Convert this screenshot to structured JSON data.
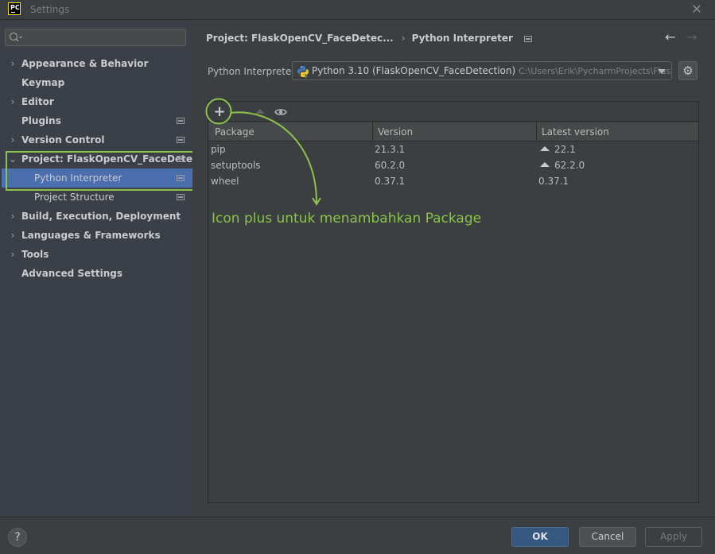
{
  "window": {
    "title": "Settings",
    "app_logo": "PC"
  },
  "sidebar": {
    "search": {
      "value": "",
      "placeholder": ""
    },
    "items": [
      {
        "label": "Appearance & Behavior",
        "expandable": true,
        "expanded": false
      },
      {
        "label": "Keymap",
        "expandable": false
      },
      {
        "label": "Editor",
        "expandable": true,
        "expanded": false
      },
      {
        "label": "Plugins",
        "expandable": false,
        "project_icon": true
      },
      {
        "label": "Version Control",
        "expandable": true,
        "expanded": false,
        "project_icon": true
      },
      {
        "label": "Project: FlaskOpenCV_FaceDetec...",
        "expandable": true,
        "expanded": true,
        "project_icon": true
      },
      {
        "label": "Python Interpreter",
        "child": true,
        "selected": true,
        "project_icon": true
      },
      {
        "label": "Project Structure",
        "child": true,
        "project_icon": true
      },
      {
        "label": "Build, Execution, Deployment",
        "expandable": true,
        "expanded": false
      },
      {
        "label": "Languages & Frameworks",
        "expandable": true,
        "expanded": false
      },
      {
        "label": "Tools",
        "expandable": true,
        "expanded": false
      },
      {
        "label": "Advanced Settings",
        "expandable": false
      }
    ]
  },
  "main": {
    "breadcrumb": {
      "parent": "Project: FlaskOpenCV_FaceDetec...",
      "separator": "›",
      "current": "Python Interpreter"
    },
    "interpreter": {
      "label": "Python Interpreter:",
      "name": "Python 3.10 (FlaskOpenCV_FaceDetection)",
      "path": "C:\\Users\\Erik\\PycharmProjects\\FlaskOpe"
    },
    "toolbar": {
      "add": "+",
      "remove": "−"
    },
    "packages": {
      "columns": [
        "Package",
        "Version",
        "Latest version"
      ],
      "rows": [
        {
          "package": "pip",
          "version": "21.3.1",
          "latest": "22.1",
          "upgrade": true
        },
        {
          "package": "setuptools",
          "version": "60.2.0",
          "latest": "62.2.0",
          "upgrade": true
        },
        {
          "package": "wheel",
          "version": "0.37.1",
          "latest": "0.37.1",
          "upgrade": false
        }
      ]
    },
    "annotation": {
      "text": "Icon plus untuk menambahkan Package",
      "color": "#8bc34a"
    }
  },
  "footer": {
    "help": "?",
    "ok": "OK",
    "cancel": "Cancel",
    "apply": "Apply"
  },
  "colors": {
    "selection": "#4b6eaf",
    "primary_button": "#365880",
    "annotation": "#8bc34a"
  }
}
